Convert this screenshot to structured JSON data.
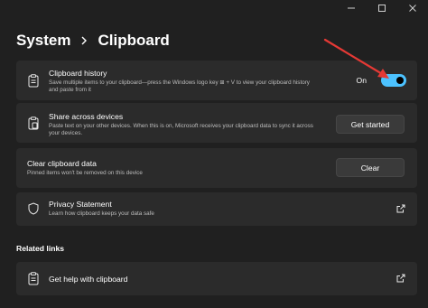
{
  "window": {
    "controls": [
      "minimize",
      "maximize",
      "close"
    ],
    "accent_color": "#4cc2ff",
    "annotation_arrow_color": "#e53935"
  },
  "breadcrumb": {
    "parent": "System",
    "current": "Clipboard"
  },
  "cards": {
    "history": {
      "icon": "clipboard-icon",
      "title": "Clipboard history",
      "description": "Save multiple items to your clipboard—press the Windows logo key ⊞ + V to view your clipboard history and paste from it",
      "toggle_label": "On",
      "toggle_on": true
    },
    "share": {
      "icon": "clipboard-share-icon",
      "title": "Share across devices",
      "description": "Paste text on your other devices. When this is on, Microsoft receives your clipboard data to sync it across your devices.",
      "button": "Get started"
    },
    "clear": {
      "title": "Clear clipboard data",
      "description": "Pinned items won't be removed on this device",
      "button": "Clear"
    },
    "privacy": {
      "icon": "shield-icon",
      "title": "Privacy Statement",
      "description": "Learn how clipboard keeps your data safe"
    }
  },
  "related": {
    "heading": "Related links",
    "help": {
      "icon": "clipboard-icon",
      "title": "Get help with clipboard"
    }
  }
}
